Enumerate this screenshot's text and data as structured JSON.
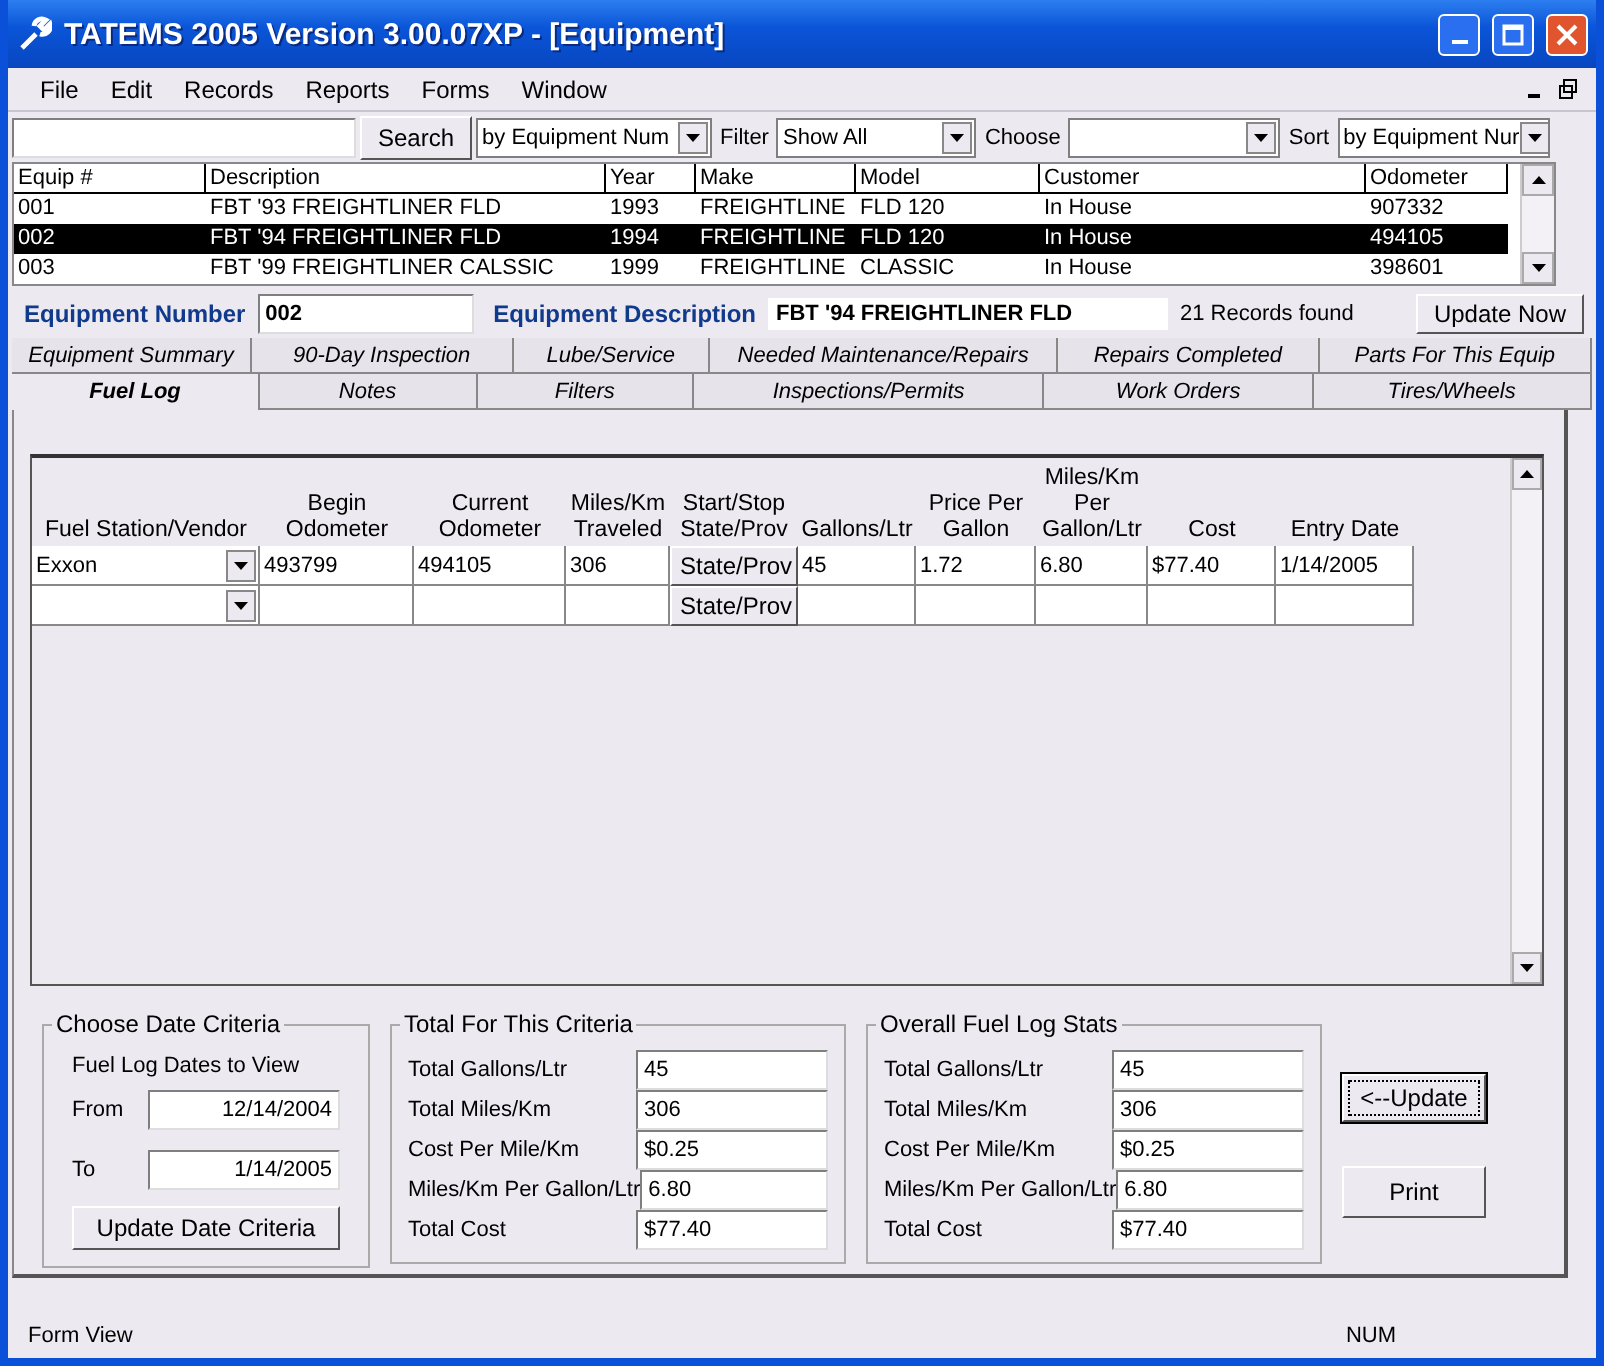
{
  "window": {
    "title": "TATEMS 2005 Version 3.00.07XP - [Equipment]"
  },
  "menu": [
    "File",
    "Edit",
    "Records",
    "Reports",
    "Forms",
    "Window"
  ],
  "toolbar": {
    "search_button": "Search",
    "search_by": "by Equipment Num",
    "filter_label": "Filter",
    "filter": "Show All",
    "choose_label": "Choose",
    "sort_label": "Sort",
    "sort": "by Equipment Nur"
  },
  "equipment_table": {
    "columns": [
      "Equip #",
      "Description",
      "Year",
      "Make",
      "Model",
      "Customer",
      "Odometer"
    ],
    "rows": [
      {
        "selected": false,
        "cells": [
          "001",
          "FBT '93 FREIGHTLINER FLD",
          "1993",
          "FREIGHTLINE",
          "FLD 120",
          "In House",
          "907332"
        ]
      },
      {
        "selected": true,
        "cells": [
          "002",
          "FBT '94 FREIGHTLINER FLD",
          "1994",
          "FREIGHTLINE",
          "FLD 120",
          "In House",
          "494105"
        ]
      },
      {
        "selected": false,
        "cells": [
          "003",
          "FBT '99 FREIGHTLINER CALSSIC",
          "1999",
          "FREIGHTLINE",
          "CLASSIC",
          "In House",
          "398601"
        ]
      }
    ]
  },
  "record": {
    "number_label": "Equipment Number",
    "number": "002",
    "description_label": "Equipment Description",
    "description": "FBT '94 FREIGHTLINER FLD",
    "records_found": "21 Records found",
    "update_button": "Update Now"
  },
  "tabs": [
    [
      {
        "label": "Equipment Summary",
        "selected": false
      },
      {
        "label": "90-Day Inspection",
        "selected": false
      },
      {
        "label": "Lube/Service",
        "selected": false
      },
      {
        "label": "Needed Maintenance/Repairs",
        "selected": false
      },
      {
        "label": "Repairs Completed",
        "selected": false
      },
      {
        "label": "Parts For This Equip",
        "selected": false
      }
    ],
    [
      {
        "label": "Fuel Log",
        "selected": true
      },
      {
        "label": "Notes",
        "selected": false
      },
      {
        "label": "Filters",
        "selected": false
      },
      {
        "label": "Inspections/Permits",
        "selected": false
      },
      {
        "label": "Work Orders",
        "selected": false
      },
      {
        "label": "Tires/Wheels",
        "selected": false
      }
    ]
  ],
  "fuel_log": {
    "columns": [
      "Fuel Station/Vendor",
      "Begin\nOdometer",
      "Current\nOdometer",
      "Miles/Km\nTraveled",
      "Start/Stop\nState/Prov",
      "Gallons/Ltr",
      "Price Per\nGallon",
      "Miles/Km\nPer\nGallon/Ltr",
      "Cost",
      "Entry Date"
    ],
    "rows": [
      {
        "vendor": "Exxon",
        "begin": "493799",
        "current": "494105",
        "miles": "306",
        "state_button": "State/Prov",
        "gallons": "45",
        "price": "1.72",
        "mpg": "6.80",
        "cost": "$77.40",
        "date": "1/14/2005"
      },
      {
        "vendor": "",
        "begin": "",
        "current": "",
        "miles": "",
        "state_button": "State/Prov",
        "gallons": "",
        "price": "",
        "mpg": "",
        "cost": "",
        "date": ""
      }
    ]
  },
  "date_criteria": {
    "title": "Choose Date Criteria",
    "subtitle": "Fuel Log Dates to View",
    "from_label": "From",
    "from": "12/14/2004",
    "to_label": "To",
    "to": "1/14/2005",
    "button": "Update Date Criteria"
  },
  "stat_groups": [
    {
      "title": "Total For This Criteria",
      "items": [
        {
          "label": "Total Gallons/Ltr",
          "value": "45"
        },
        {
          "label": "Total Miles/Km",
          "value": "306"
        },
        {
          "label": "Cost Per Mile/Km",
          "value": "$0.25"
        },
        {
          "label": "Miles/Km Per Gallon/Ltr",
          "value": "6.80"
        },
        {
          "label": "Total Cost",
          "value": "$77.40"
        }
      ]
    },
    {
      "title": "Overall Fuel Log Stats",
      "items": [
        {
          "label": "Total Gallons/Ltr",
          "value": "45"
        },
        {
          "label": "Total Miles/Km",
          "value": "306"
        },
        {
          "label": "Cost Per Mile/Km",
          "value": "$0.25"
        },
        {
          "label": "Miles/Km Per Gallon/Ltr",
          "value": "6.80"
        },
        {
          "label": "Total Cost",
          "value": "$77.40"
        }
      ]
    }
  ],
  "update_button": "<--Update",
  "print_button": "Print",
  "status_bar": {
    "left": "Form View",
    "right": "NUM"
  }
}
